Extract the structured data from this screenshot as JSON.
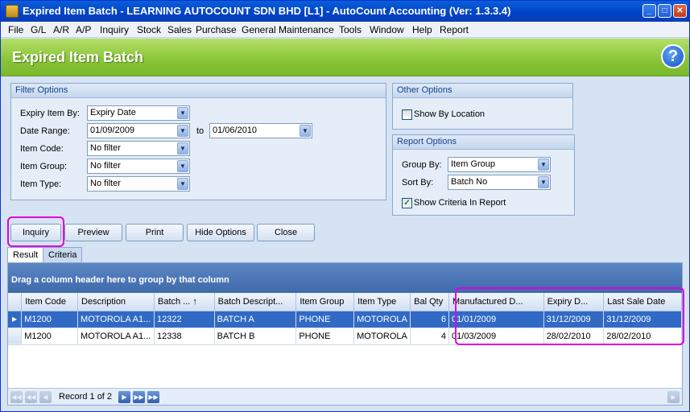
{
  "window": {
    "title": "Expired Item Batch - LEARNING AUTOCOUNT SDN BHD [L1] - AutoCount Accounting (Ver: 1.3.3.4)"
  },
  "menu": [
    "File",
    "G/L",
    "A/R",
    "A/P",
    "Inquiry",
    "Stock",
    "Sales",
    "Purchase",
    "General Maintenance",
    "Tools",
    "Window",
    "Help",
    "Report"
  ],
  "header": {
    "title": "Expired Item Batch",
    "help_glyph": "?"
  },
  "filter": {
    "title": "Filter Options",
    "expiry_by_label": "Expiry Item By:",
    "expiry_by_value": "Expiry Date",
    "date_range_label": "Date Range:",
    "date_from": "01/09/2009",
    "date_to_label": "to",
    "date_to": "01/06/2010",
    "item_code_label": "Item Code:",
    "item_code_value": "No filter",
    "item_group_label": "Item Group:",
    "item_group_value": "No filter",
    "item_type_label": "Item Type:",
    "item_type_value": "No filter"
  },
  "other": {
    "title": "Other Options",
    "show_by_location": "Show By Location",
    "show_by_location_checked": false
  },
  "report": {
    "title": "Report Options",
    "group_by_label": "Group By:",
    "group_by_value": "Item Group",
    "sort_by_label": "Sort By:",
    "sort_by_value": "Batch No",
    "show_criteria": "Show Criteria In Report",
    "show_criteria_checked": true
  },
  "buttons": {
    "inquiry": "Inquiry",
    "preview": "Preview",
    "print": "Print",
    "hide_options": "Hide Options",
    "close": "Close"
  },
  "tabs": [
    "Result",
    "Criteria"
  ],
  "grid": {
    "group_hint": "Drag a column header here to group by that column",
    "columns": [
      "Item Code",
      "Description",
      "Batch ...",
      "Batch Descript...",
      "Item Group",
      "Item Type",
      "Bal Qty",
      "Manufactured D...",
      "Expiry D...",
      "Last Sale Date"
    ],
    "sort_indicator": "↑",
    "rows": [
      [
        "M1200",
        "MOTOROLA A1...",
        "12322",
        "BATCH A",
        "PHONE",
        "MOTOROLA",
        "6",
        "01/01/2009",
        "31/12/2009",
        "31/12/2009"
      ],
      [
        "M1200",
        "MOTOROLA A1...",
        "12338",
        "BATCH B",
        "PHONE",
        "MOTOROLA",
        "4",
        "01/03/2009",
        "28/02/2010",
        "28/02/2010"
      ]
    ],
    "record_text": "Record 1 of 2"
  },
  "colors": {
    "title_bar": "#0042c8",
    "header_green": "#8bc63a",
    "selected_row": "#316ac5",
    "highlight": "#e000e0"
  }
}
